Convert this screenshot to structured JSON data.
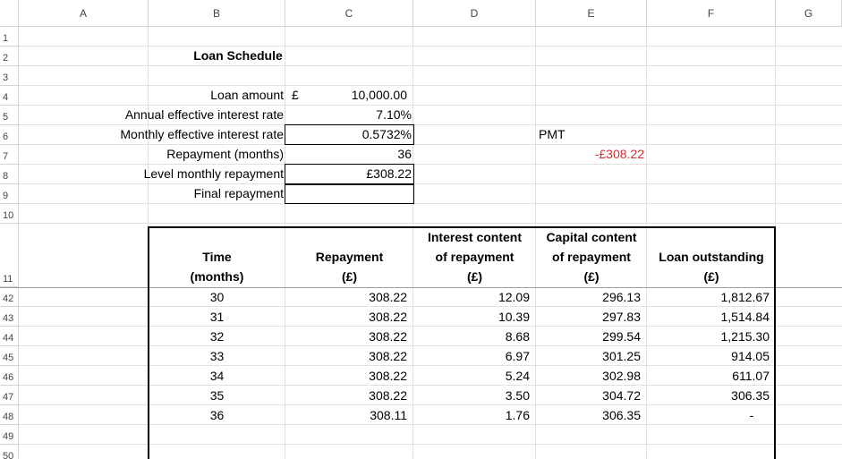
{
  "columns": [
    "A",
    "B",
    "C",
    "D",
    "E",
    "F",
    "G"
  ],
  "rows": [
    "1",
    "2",
    "3",
    "4",
    "5",
    "6",
    "7",
    "8",
    "9",
    "10",
    "11",
    "42",
    "43",
    "44",
    "45",
    "46",
    "47",
    "48",
    "49",
    "50"
  ],
  "title": "Loan Schedule",
  "inputs": {
    "loan_amount_label": "Loan amount",
    "currency_symbol": "£",
    "loan_amount": "10,000.00",
    "annual_rate_label": "Annual effective interest rate",
    "annual_rate": "7.10%",
    "monthly_rate_label": "Monthly effective interest rate",
    "monthly_rate": "0.5732%",
    "months_label": "Repayment (months)",
    "months": "36",
    "level_label": "Level monthly repayment",
    "level_value": "£308.22",
    "final_label": "Final repayment",
    "final_value": ""
  },
  "pmt": {
    "label": "PMT",
    "value": "-£308.22",
    "value_color": "#d32f2f"
  },
  "table": {
    "headers": [
      [
        "Time",
        "(months)"
      ],
      [
        "Repayment",
        "(£)"
      ],
      [
        "Interest content",
        "of repayment",
        "(£)"
      ],
      [
        "Capital content",
        "of repayment",
        "(£)"
      ],
      [
        "Loan outstanding",
        "(£)"
      ]
    ],
    "rows": [
      [
        "30",
        "308.22",
        "12.09",
        "296.13",
        "1,812.67"
      ],
      [
        "31",
        "308.22",
        "10.39",
        "297.83",
        "1,514.84"
      ],
      [
        "32",
        "308.22",
        "8.68",
        "299.54",
        "1,215.30"
      ],
      [
        "33",
        "308.22",
        "6.97",
        "301.25",
        "914.05"
      ],
      [
        "34",
        "308.22",
        "5.24",
        "302.98",
        "611.07"
      ],
      [
        "35",
        "308.22",
        "3.50",
        "304.72",
        "306.35"
      ],
      [
        "36",
        "308.11",
        "1.76",
        "306.35",
        "-"
      ]
    ]
  }
}
